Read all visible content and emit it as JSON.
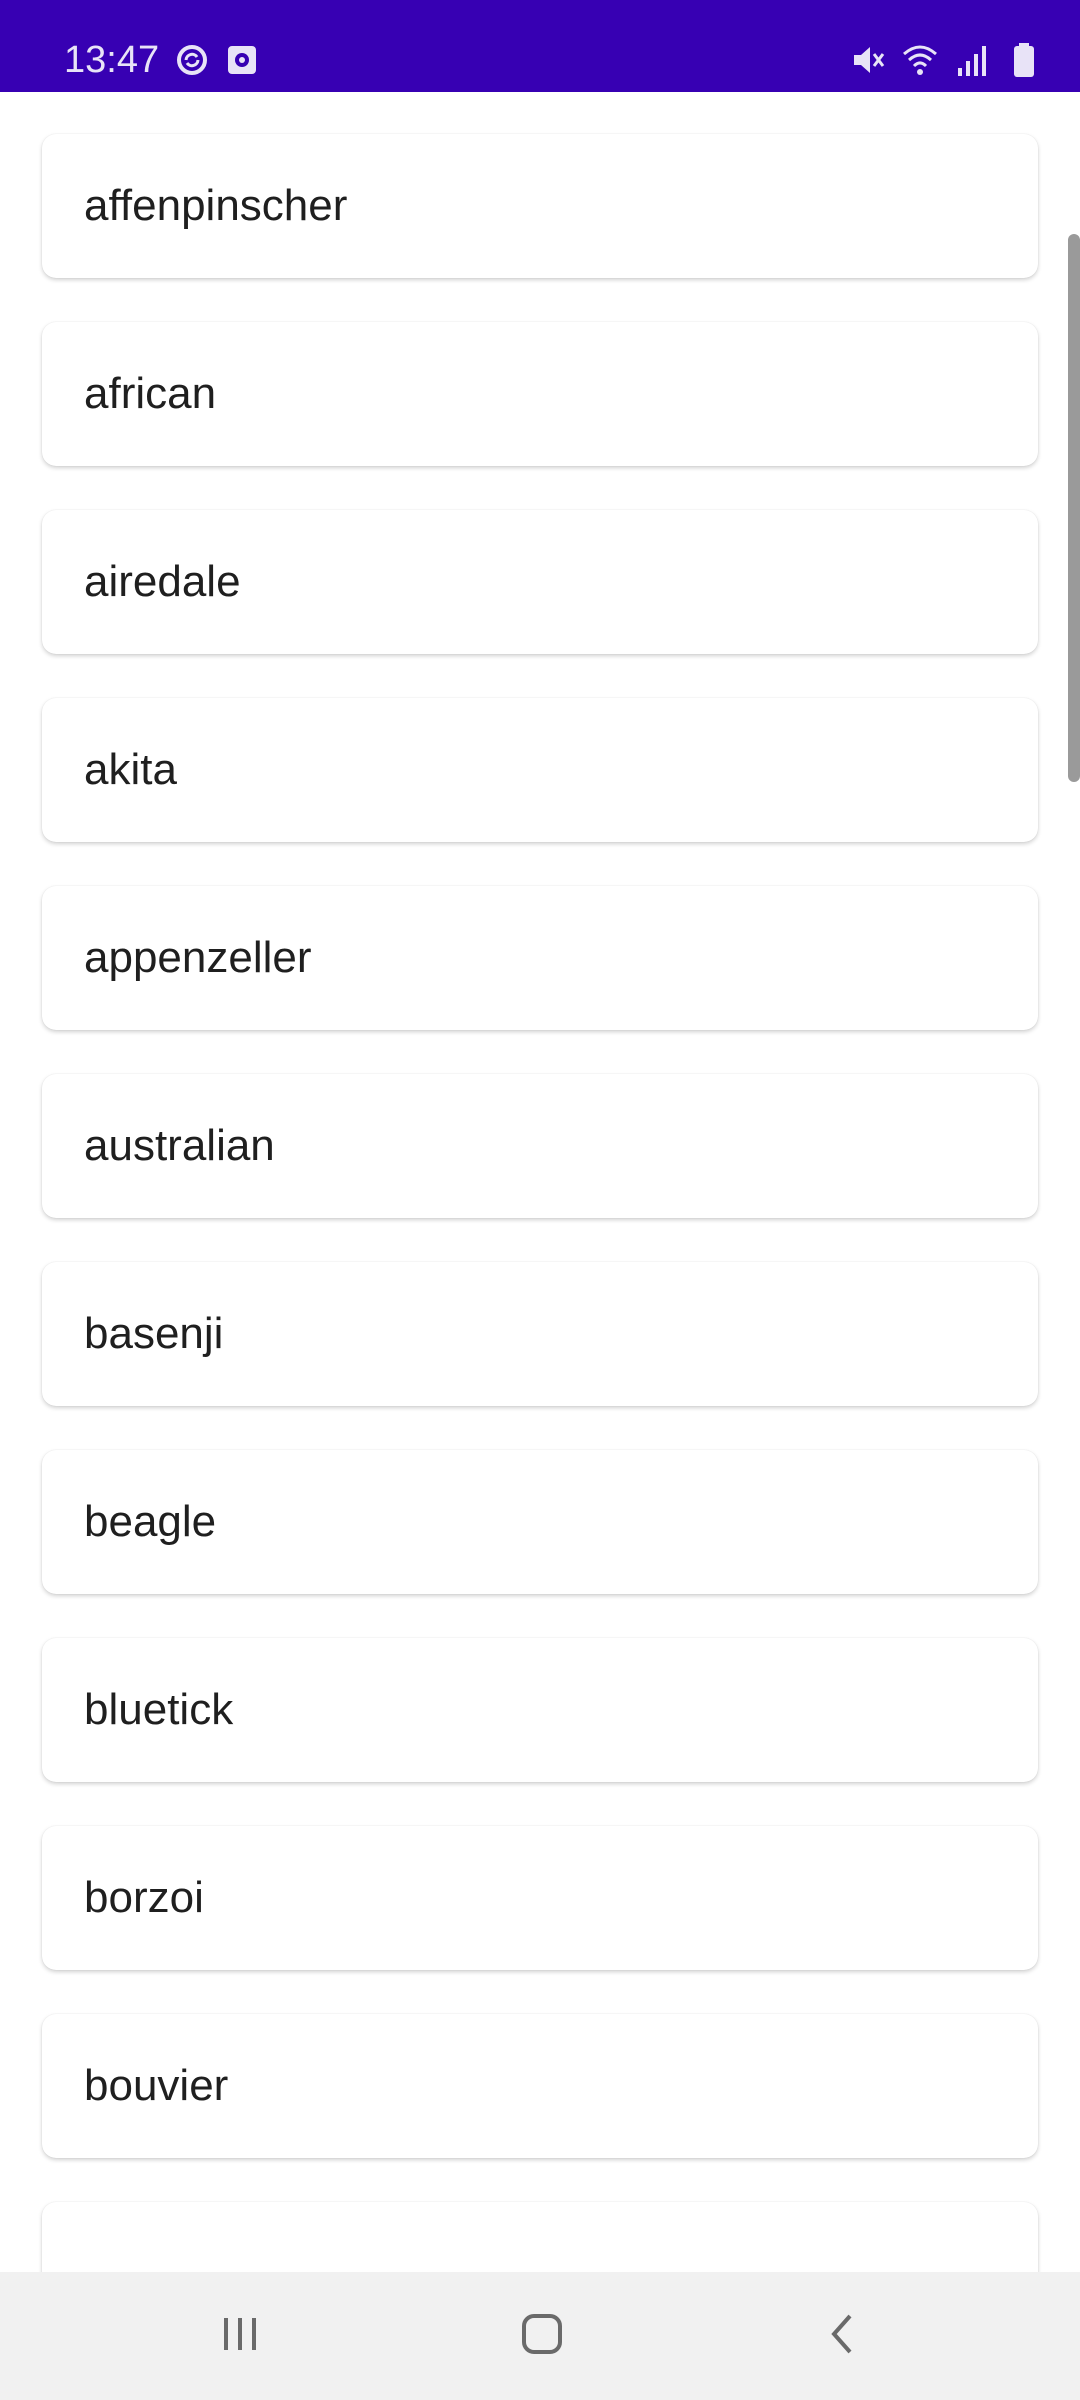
{
  "status_bar": {
    "time": "13:47",
    "background": "#3700B3",
    "left_icons": [
      "sync-icon",
      "screen-recorder-icon"
    ],
    "right_icons": [
      "mute-icon",
      "wifi-icon",
      "cellular-signal-icon",
      "battery-icon"
    ]
  },
  "breeds": [
    "affenpinscher",
    "african",
    "airedale",
    "akita",
    "appenzeller",
    "australian",
    "basenji",
    "beagle",
    "bluetick",
    "borzoi",
    "bouvier"
  ],
  "nav_bar": {
    "buttons": [
      "recents-icon",
      "home-icon",
      "back-icon"
    ]
  }
}
